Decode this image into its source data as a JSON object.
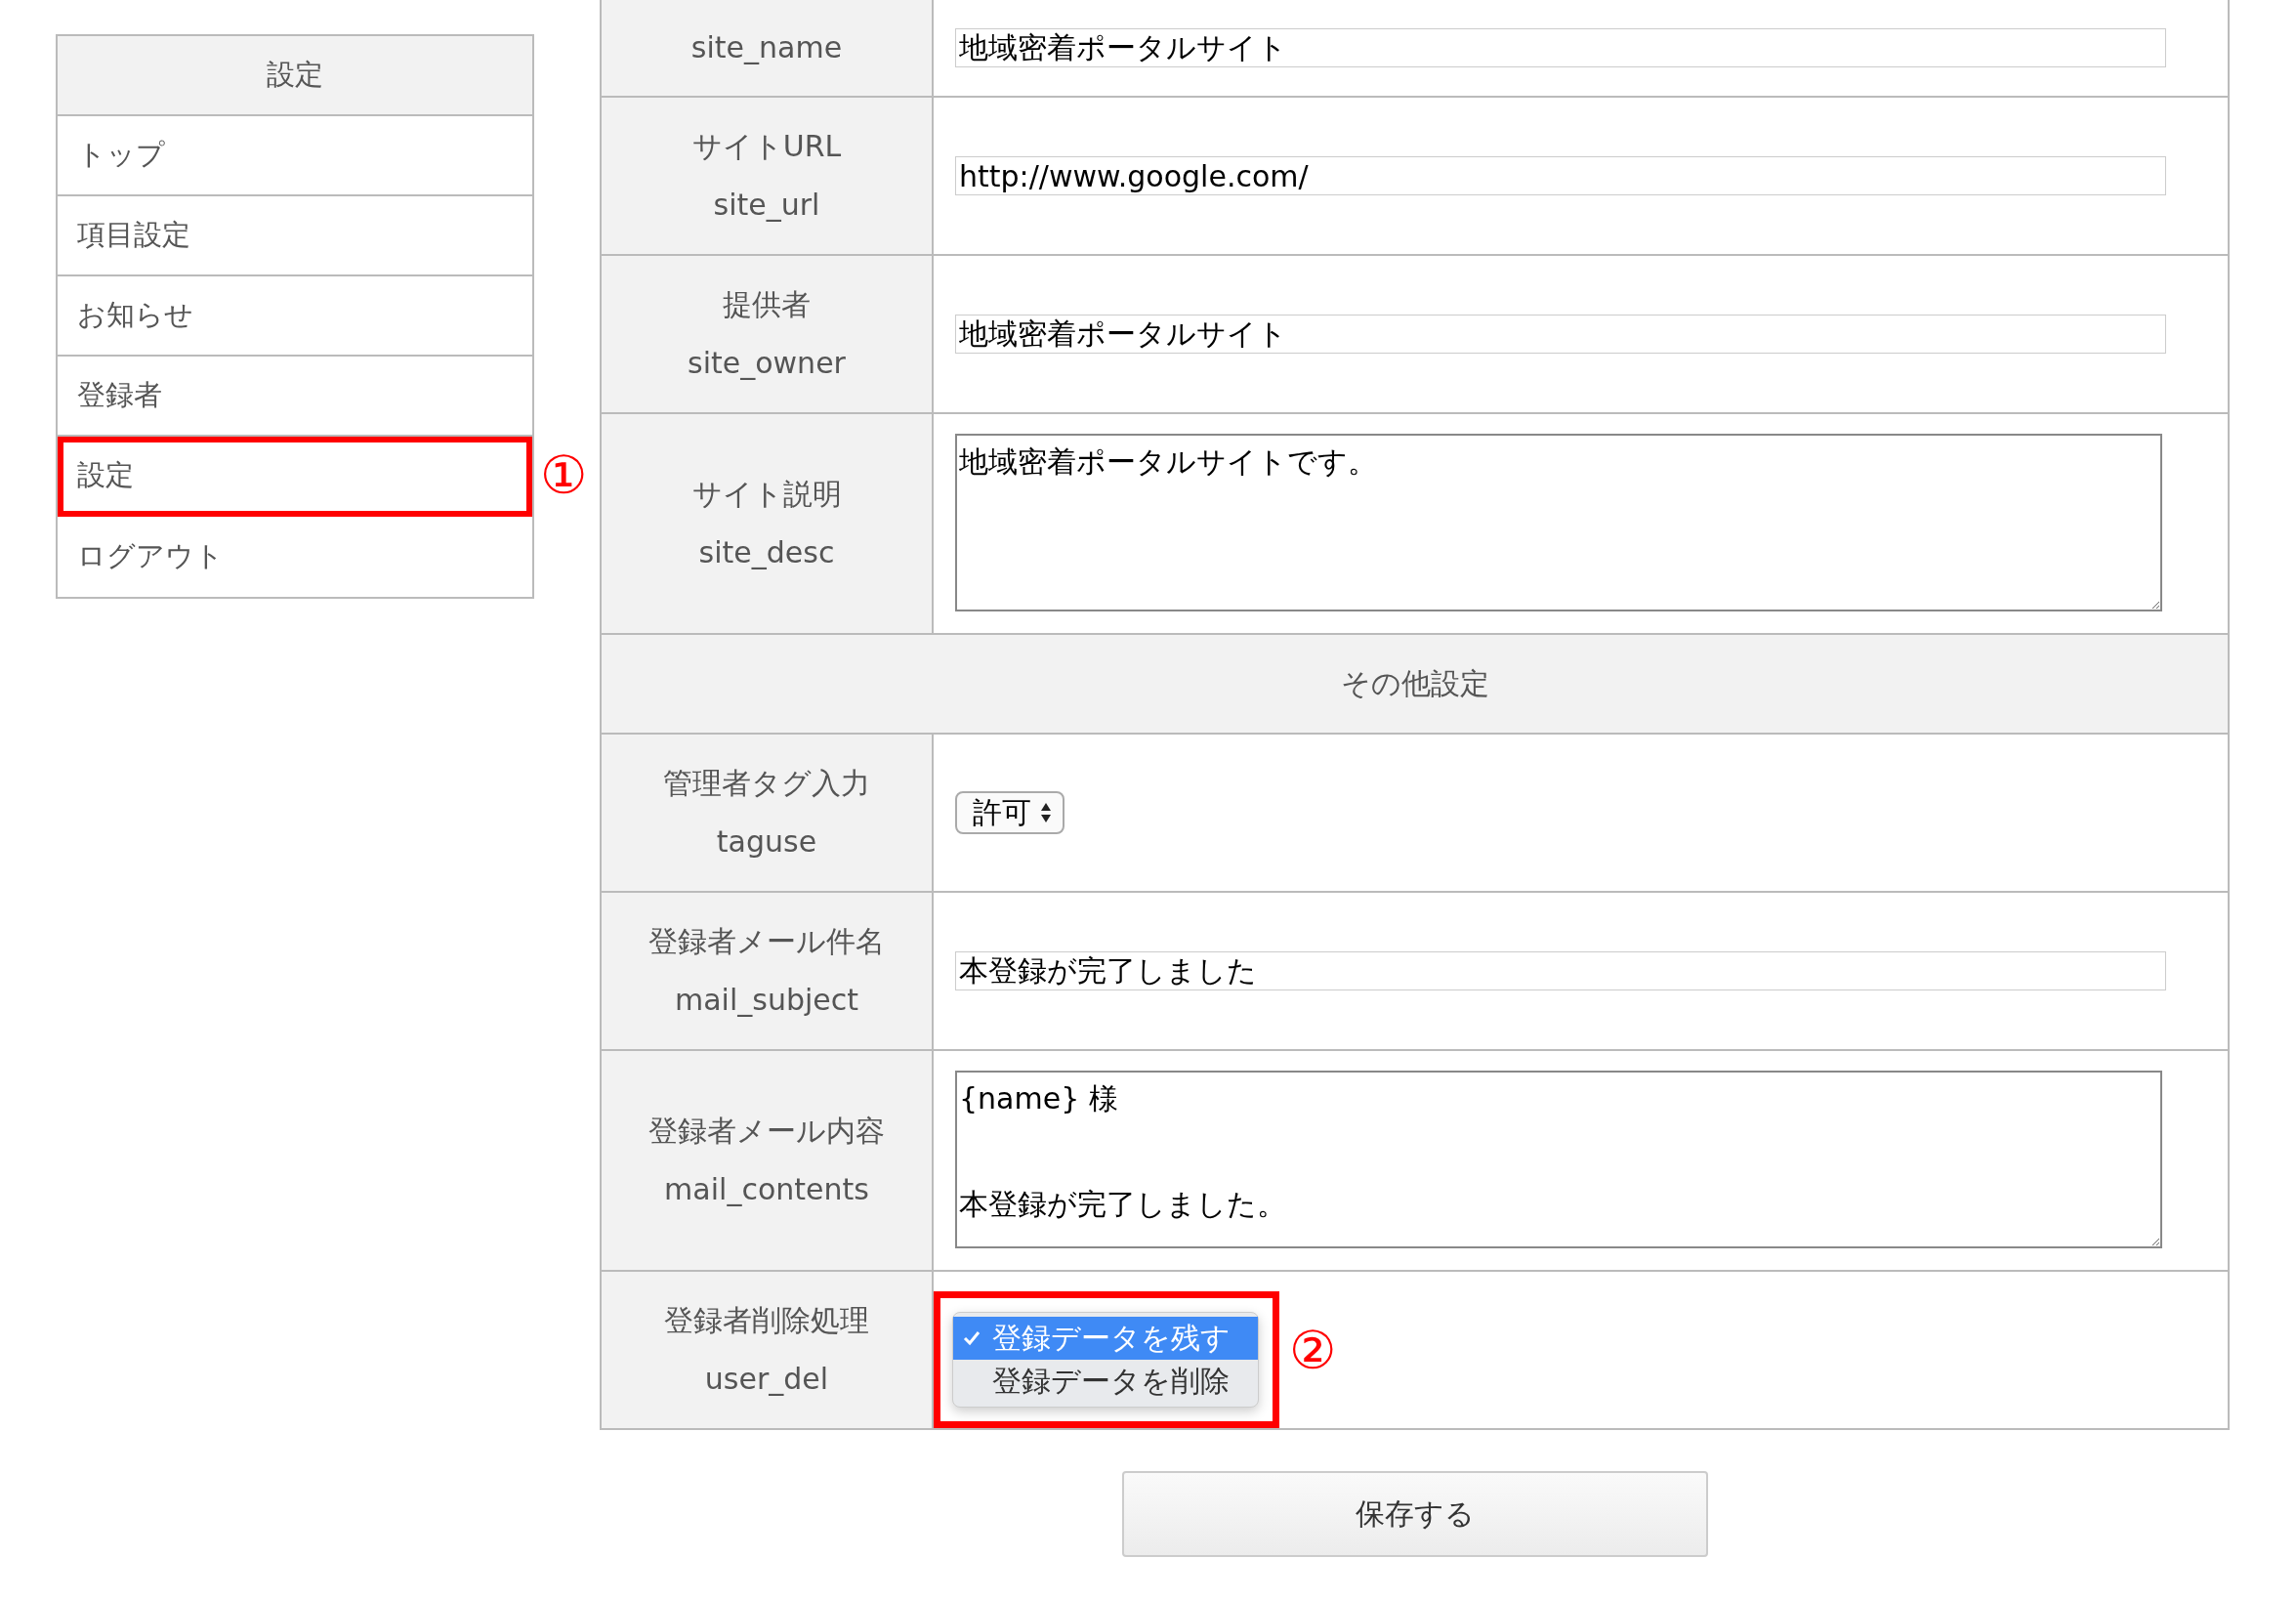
{
  "sidebar": {
    "title": "設定",
    "items": [
      {
        "label": "トップ",
        "selected": false
      },
      {
        "label": "項目設定",
        "selected": false
      },
      {
        "label": "お知らせ",
        "selected": false
      },
      {
        "label": "登録者",
        "selected": false
      },
      {
        "label": "設定",
        "selected": true,
        "marker": "①"
      },
      {
        "label": "ログアウト",
        "selected": false
      }
    ]
  },
  "rows": [
    {
      "kind": "text",
      "key": "site_name",
      "value": "地域密着ポータルサイト"
    },
    {
      "kind": "text",
      "label": "サイトURL",
      "key": "site_url",
      "value": "http://www.google.com/"
    },
    {
      "kind": "text",
      "label": "提供者",
      "key": "site_owner",
      "value": "地域密着ポータルサイト"
    },
    {
      "kind": "textarea",
      "label": "サイト説明",
      "key": "site_desc",
      "value": "地域密着ポータルサイトです。"
    },
    {
      "kind": "section",
      "label": "その他設定"
    },
    {
      "kind": "select",
      "label": "管理者タグ入力",
      "key": "taguse",
      "value": "許可"
    },
    {
      "kind": "text",
      "label": "登録者メール件名",
      "key": "mail_subject",
      "value": "本登録が完了しました"
    },
    {
      "kind": "textarea_scroll",
      "label": "登録者メール内容",
      "key": "mail_contents",
      "lines": [
        "{name} 様",
        "本登録が完了しました。"
      ]
    },
    {
      "kind": "menu",
      "label": "登録者削除処理",
      "key": "user_del",
      "marker": "②",
      "options": [
        {
          "label": "登録データを残す",
          "selected": true
        },
        {
          "label": "登録データを削除",
          "selected": false
        }
      ]
    }
  ],
  "save_button": "保存する"
}
